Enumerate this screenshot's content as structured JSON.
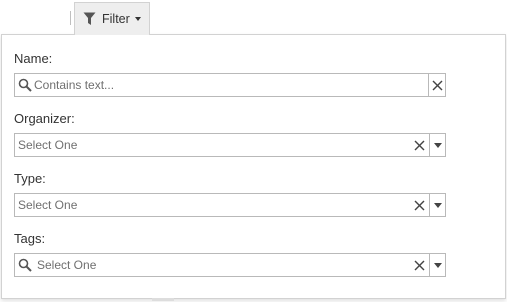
{
  "toolbar": {
    "filter_label": "Filter"
  },
  "filter_panel": {
    "fields": [
      {
        "label": "Name:",
        "placeholder": "Contains text...",
        "kind": "text-search"
      },
      {
        "label": "Organizer:",
        "value": "Select One",
        "kind": "select"
      },
      {
        "label": "Type:",
        "value": "Select One",
        "kind": "select"
      },
      {
        "label": "Tags:",
        "value": "Select One",
        "kind": "search-select"
      }
    ]
  },
  "icons": {
    "filter": "funnel-icon",
    "caret": "caret-down-icon",
    "search": "search-icon",
    "clear": "close-icon",
    "dropdown": "chevron-down-icon"
  },
  "colors": {
    "tab_background": "#eeeeee",
    "border": "#d2d2d2",
    "field_border": "#b9b9b9",
    "text": "#333333",
    "placeholder_text": "#6f6f6f"
  }
}
